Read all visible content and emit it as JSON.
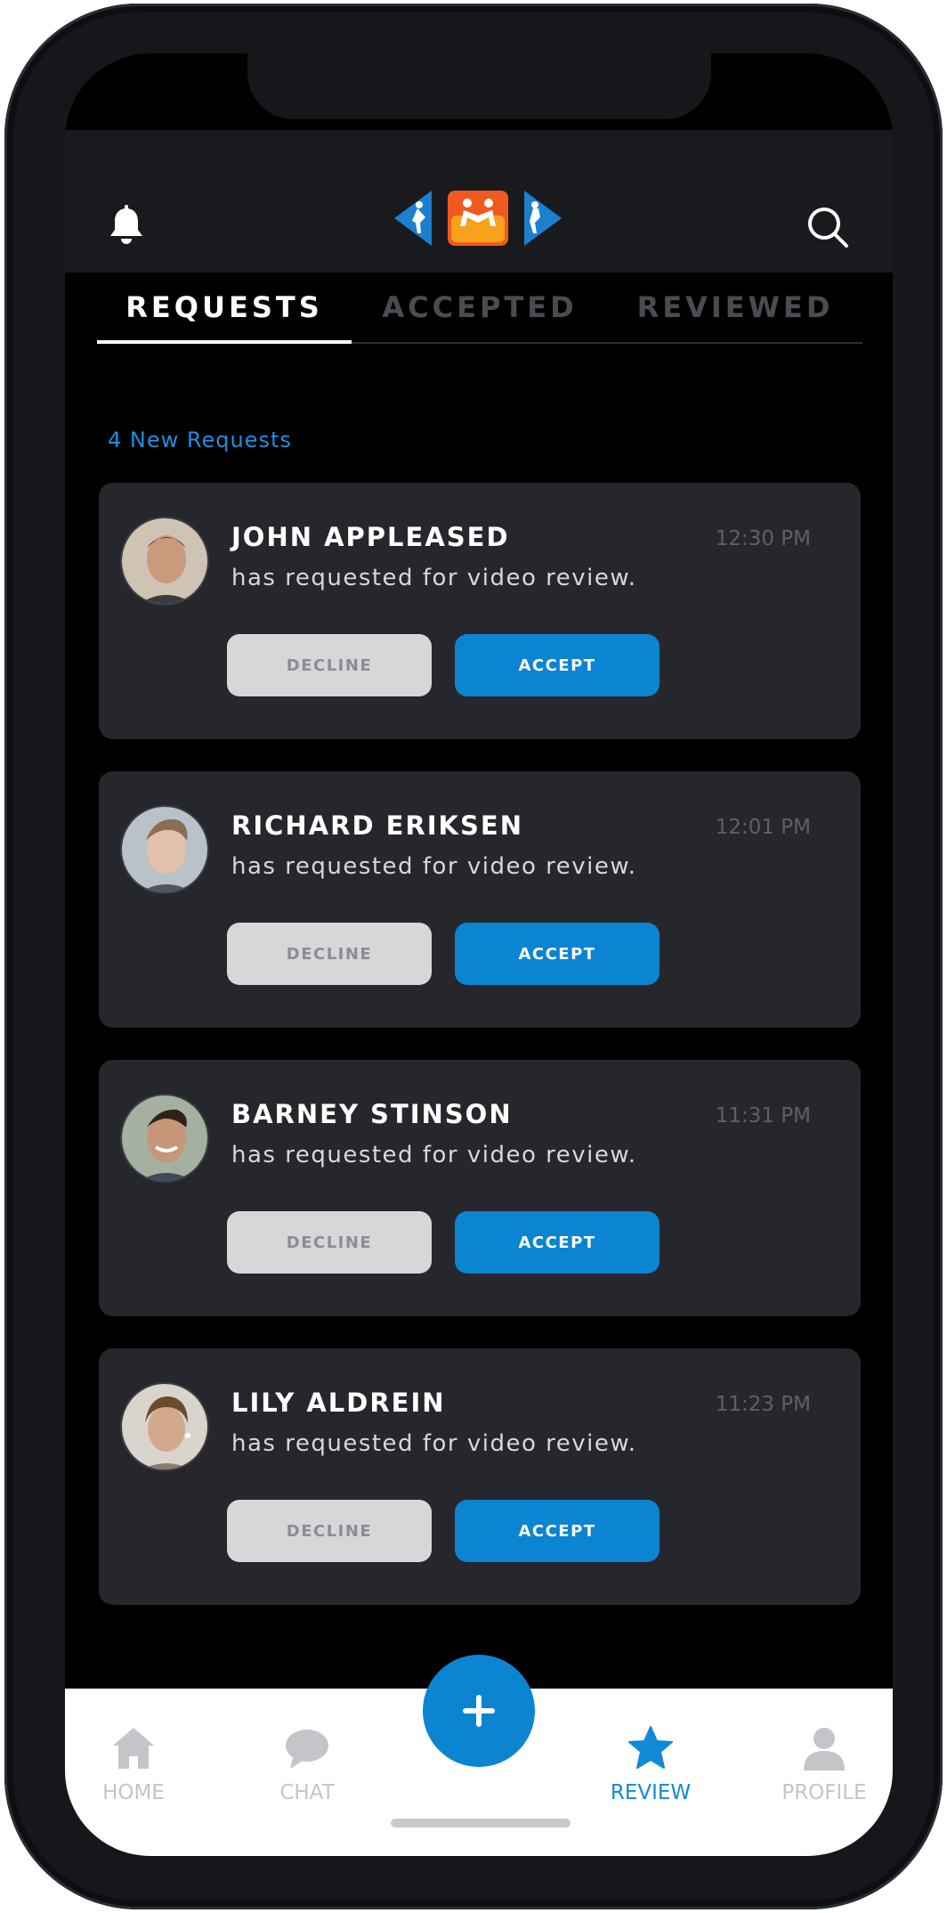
{
  "header": {
    "bell_icon": "bell-icon",
    "search_icon": "search-icon",
    "logo": "sports-logo"
  },
  "tabs": [
    {
      "label": "REQUESTS",
      "active": true
    },
    {
      "label": "ACCEPTED",
      "active": false
    },
    {
      "label": "REVIEWED",
      "active": false
    }
  ],
  "new_requests_label": "4 New Requests",
  "requests": [
    {
      "name": "JOHN APPLEASED",
      "message": "has requested for video review.",
      "time": "12:30 PM",
      "decline_label": "DECLINE",
      "accept_label": "ACCEPT",
      "avatar_color": "#8a6a52"
    },
    {
      "name": "RICHARD ERIKSEN",
      "message": "has requested for video review.",
      "time": "12:01 PM",
      "decline_label": "DECLINE",
      "accept_label": "ACCEPT",
      "avatar_color": "#b99a86"
    },
    {
      "name": "BARNEY STINSON",
      "message": "has requested for video review.",
      "time": "11:31 PM",
      "decline_label": "DECLINE",
      "accept_label": "ACCEPT",
      "avatar_color": "#7e6150"
    },
    {
      "name": "LILY ALDREIN",
      "message": "has requested for video review.",
      "time": "11:23 PM",
      "decline_label": "DECLINE",
      "accept_label": "ACCEPT",
      "avatar_color": "#a68a70"
    }
  ],
  "bottom_nav": {
    "items": [
      {
        "label": "HOME",
        "icon": "home-icon",
        "active": false
      },
      {
        "label": "CHAT",
        "icon": "chat-icon",
        "active": false
      },
      {
        "label": "REVIEW",
        "icon": "star-icon",
        "active": true
      },
      {
        "label": "PROFILE",
        "icon": "profile-icon",
        "active": false
      }
    ],
    "fab_icon": "plus-icon"
  },
  "colors": {
    "accent": "#0b84d2",
    "card": "#26272c",
    "background": "#000000"
  }
}
